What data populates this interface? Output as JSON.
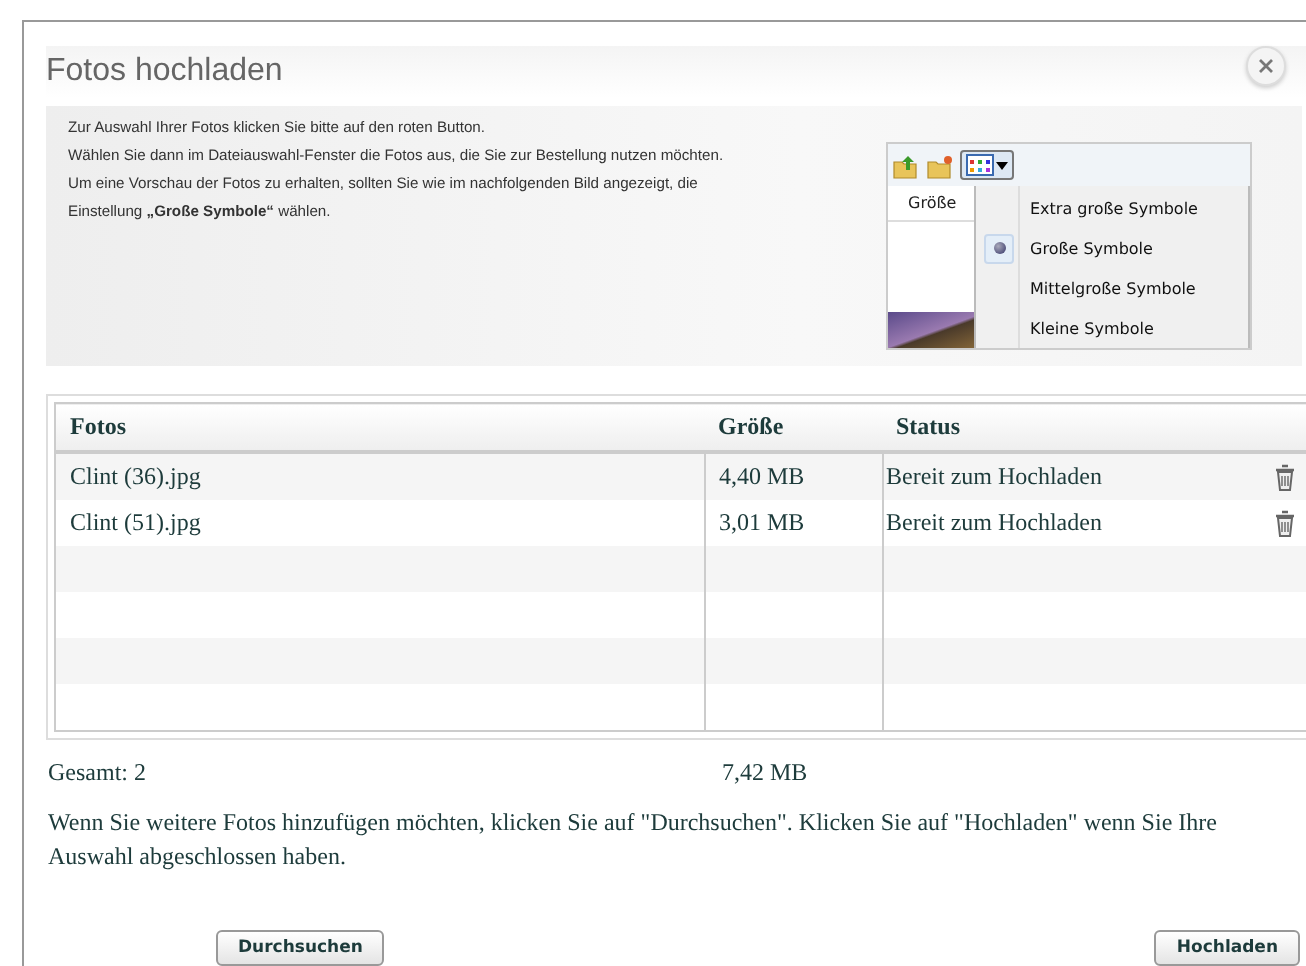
{
  "dialog": {
    "title": "Fotos hochladen"
  },
  "instructions": [
    "Zur Auswahl Ihrer Fotos klicken Sie bitte auf den roten Button.",
    "Wählen Sie dann im Dateiauswahl-Fenster die Fotos aus, die Sie zur Bestellung nutzen möchten.",
    "Um eine Vorschau der Fotos zu erhalten, sollten Sie wie im nachfolgenden Bild angezeigt, die Einstellung **„Große Symbole“** wählen."
  ],
  "example": {
    "column_header": "Größe",
    "menu": [
      {
        "label": "Extra große Symbole",
        "selected": false
      },
      {
        "label": "Große Symbole",
        "selected": true
      },
      {
        "label": "Mittelgroße Symbole",
        "selected": false
      },
      {
        "label": "Kleine Symbole",
        "selected": false
      }
    ]
  },
  "table": {
    "columns": [
      "Fotos",
      "Größe",
      "Status"
    ],
    "rows": [
      {
        "name": "Clint (36).jpg",
        "size": "4,40 MB",
        "status": "Bereit zum Hochladen"
      },
      {
        "name": "Clint (51).jpg",
        "size": "3,01 MB",
        "status": "Bereit zum Hochladen"
      }
    ]
  },
  "total": {
    "label": "Gesamt: 2",
    "size": "7,42 MB"
  },
  "hint": "Wenn Sie weitere Fotos hinzufügen möchten, klicken Sie auf \"Durchsuchen\". Klicken Sie auf \"Hochladen\" wenn Sie Ihre Auswahl abgeschlossen haben.",
  "buttons": [
    "Durchsuchen",
    "Hochladen"
  ]
}
